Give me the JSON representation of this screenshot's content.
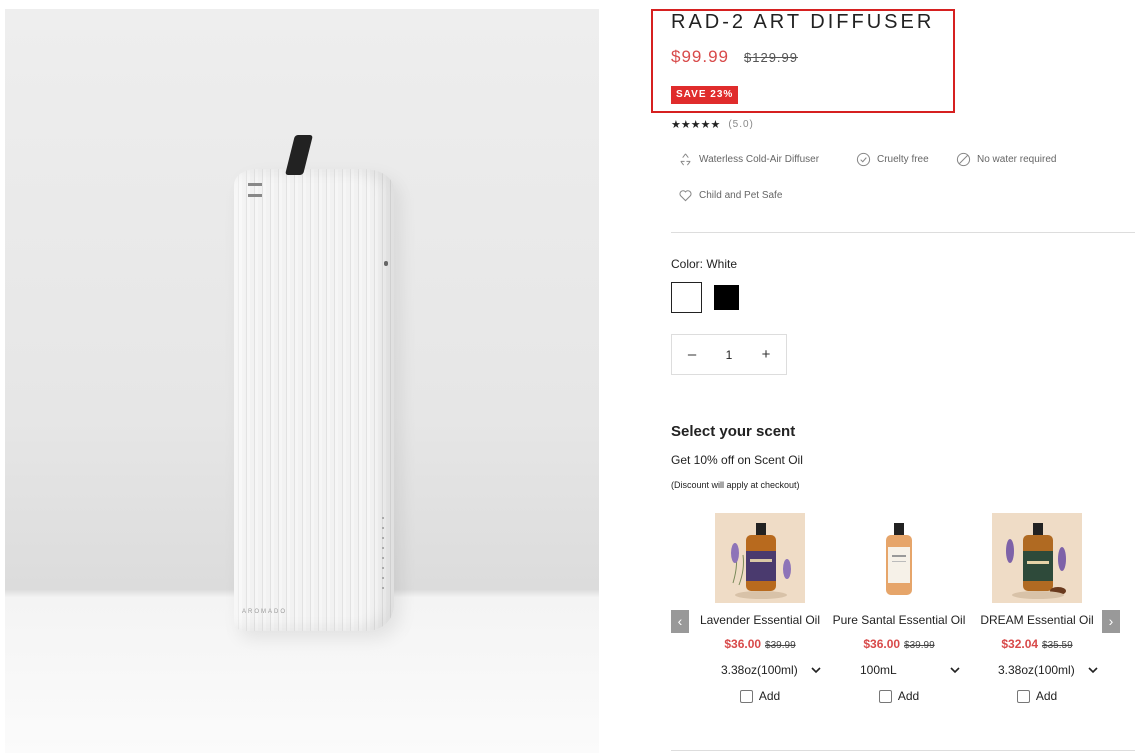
{
  "product": {
    "title": "RAD-2 ART DIFFUSER",
    "price": "$99.99",
    "compare_price": "$129.99",
    "save_badge": "SAVE 23%",
    "stars": "★★★★★",
    "rating": "(5.0)",
    "image_brand_text": "AROMADO"
  },
  "features": [
    {
      "label": "Waterless Cold-Air Diffuser",
      "icon": "recycle-icon"
    },
    {
      "label": "Cruelty free",
      "icon": "check-circle-icon"
    },
    {
      "label": "No water required",
      "icon": "no-water-icon"
    },
    {
      "label": "Child and Pet Safe",
      "icon": "heart-icon"
    }
  ],
  "color": {
    "label": "Color: White",
    "options": [
      "White",
      "Black"
    ]
  },
  "quantity": {
    "minus": "–",
    "value": "1",
    "plus": "+"
  },
  "scent": {
    "title": "Select your scent",
    "subtitle": "Get 10% off on Scent Oil",
    "note": "(Discount will apply at checkout)",
    "arrow_left": "‹",
    "arrow_right": "›",
    "items": [
      {
        "name": "Lavender Essential Oil",
        "sale": "$36.00",
        "was": "$39.99",
        "option": "3.38oz(100ml)",
        "add": "Add"
      },
      {
        "name": "Pure Santal Essential Oil",
        "sale": "$36.00",
        "was": "$39.99",
        "option": "100mL",
        "add": "Add"
      },
      {
        "name": "DREAM Essential Oil",
        "sale": "$32.04",
        "was": "$35.59",
        "option": "3.38oz(100ml)",
        "add": "Add"
      }
    ]
  },
  "colors": {
    "sale_red": "#d84a4a",
    "badge_red": "#e02c2c",
    "highlight_red": "#d62020"
  }
}
